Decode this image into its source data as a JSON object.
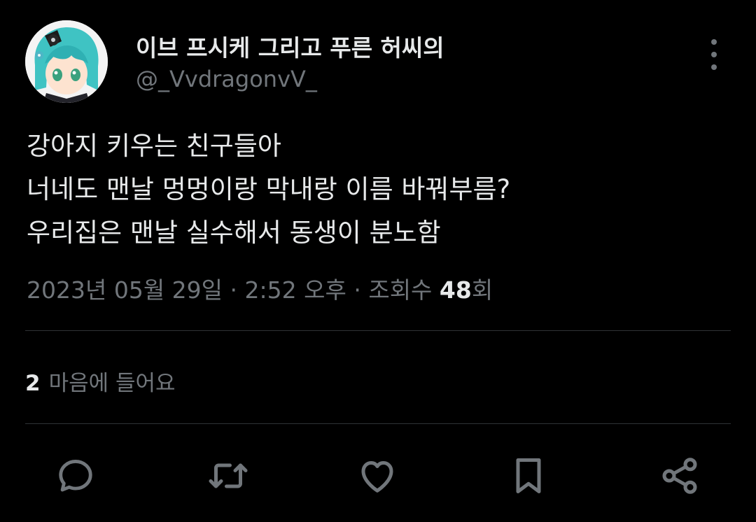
{
  "author": {
    "display_name": "이브 프시케 그리고 푸른 허씨의",
    "handle": "@_VvdragonvV_"
  },
  "tweet": {
    "lines": [
      "강아지 키우는 친구들아",
      "너네도 맨날 멍멍이랑 막내랑 이름 바꿔부름?",
      "우리집은 맨날 실수해서 동생이 분노함"
    ]
  },
  "meta": {
    "date": "2023년 05월 29일",
    "separator": " · ",
    "time": "2:52 오후",
    "views_prefix": "조회수 ",
    "views_count": "48",
    "views_suffix": "회"
  },
  "likes": {
    "count": "2",
    "label": "마음에 들어요"
  },
  "actions": {
    "icons": [
      "reply-icon",
      "retweet-icon",
      "like-icon",
      "bookmark-icon",
      "share-icon"
    ]
  },
  "colors": {
    "background": "#000000",
    "primary_text": "#e7e9ea",
    "secondary_text": "#71767b",
    "divider": "#2f3336"
  }
}
